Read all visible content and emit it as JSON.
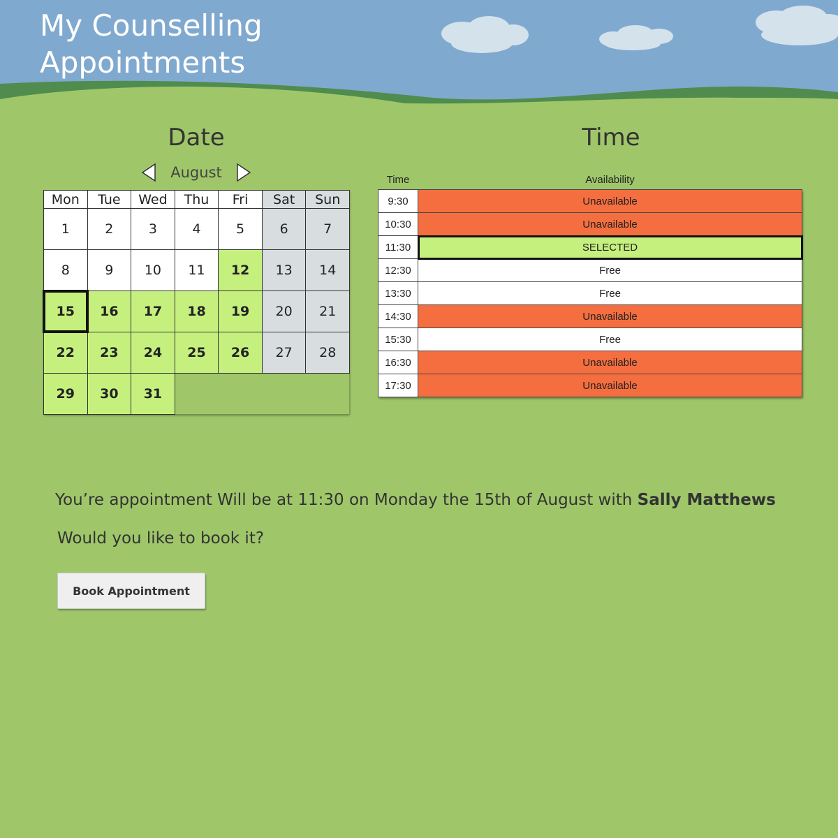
{
  "page": {
    "title_line1": "My Counselling",
    "title_line2": "Appointments"
  },
  "colors": {
    "sky": "#80a9cf",
    "grass": "#9fc76a",
    "hill_shadow": "#4f8c4e",
    "available_day": "#c5f07e",
    "weekend": "#d8dde0",
    "unavailable": "#f46e3f",
    "free": "#ffffff",
    "selected": "#c5f07e"
  },
  "date_panel": {
    "heading": "Date",
    "month": "August",
    "prev_icon": "chevron-left-icon",
    "next_icon": "chevron-right-icon",
    "weekdays": [
      "Mon",
      "Tue",
      "Wed",
      "Thu",
      "Fri",
      "Sat",
      "Sun"
    ],
    "weeks": [
      [
        {
          "label": "1",
          "state": "normal"
        },
        {
          "label": "2",
          "state": "normal"
        },
        {
          "label": "3",
          "state": "normal"
        },
        {
          "label": "4",
          "state": "normal"
        },
        {
          "label": "5",
          "state": "normal"
        },
        {
          "label": "6",
          "state": "weekend"
        },
        {
          "label": "7",
          "state": "weekend"
        }
      ],
      [
        {
          "label": "8",
          "state": "normal"
        },
        {
          "label": "9",
          "state": "normal"
        },
        {
          "label": "10",
          "state": "normal"
        },
        {
          "label": "11",
          "state": "normal"
        },
        {
          "label": "12",
          "state": "available"
        },
        {
          "label": "13",
          "state": "weekend"
        },
        {
          "label": "14",
          "state": "weekend"
        }
      ],
      [
        {
          "label": "15",
          "state": "selected"
        },
        {
          "label": "16",
          "state": "available"
        },
        {
          "label": "17",
          "state": "available"
        },
        {
          "label": "18",
          "state": "available"
        },
        {
          "label": "19",
          "state": "available"
        },
        {
          "label": "20",
          "state": "weekend"
        },
        {
          "label": "21",
          "state": "weekend"
        }
      ],
      [
        {
          "label": "22",
          "state": "available"
        },
        {
          "label": "23",
          "state": "available"
        },
        {
          "label": "24",
          "state": "available"
        },
        {
          "label": "25",
          "state": "available"
        },
        {
          "label": "26",
          "state": "available"
        },
        {
          "label": "27",
          "state": "weekend"
        },
        {
          "label": "28",
          "state": "weekend"
        }
      ],
      [
        {
          "label": "29",
          "state": "available"
        },
        {
          "label": "30",
          "state": "available"
        },
        {
          "label": "31",
          "state": "available"
        },
        null,
        null,
        null,
        null
      ]
    ]
  },
  "time_panel": {
    "heading": "Time",
    "col_time": "Time",
    "col_availability": "Availability",
    "slots": [
      {
        "time": "9:30",
        "status": "Unavailable",
        "state": "unavailable"
      },
      {
        "time": "10:30",
        "status": "Unavailable",
        "state": "unavailable"
      },
      {
        "time": "11:30",
        "status": "SELECTED",
        "state": "selected"
      },
      {
        "time": "12:30",
        "status": "Free",
        "state": "free"
      },
      {
        "time": "13:30",
        "status": "Free",
        "state": "free"
      },
      {
        "time": "14:30",
        "status": "Unavailable",
        "state": "unavailable"
      },
      {
        "time": "15:30",
        "status": "Free",
        "state": "free"
      },
      {
        "time": "16:30",
        "status": "Unavailable",
        "state": "unavailable"
      },
      {
        "time": "17:30",
        "status": "Unavailable",
        "state": "unavailable"
      }
    ]
  },
  "confirmation": {
    "sentence": "You’re appointment Will be at 11:30 on Monday the 15th of August with ",
    "counsellor": "Sally Matthews",
    "question": "Would you like to book it?",
    "button_label": "Book Appointment"
  }
}
